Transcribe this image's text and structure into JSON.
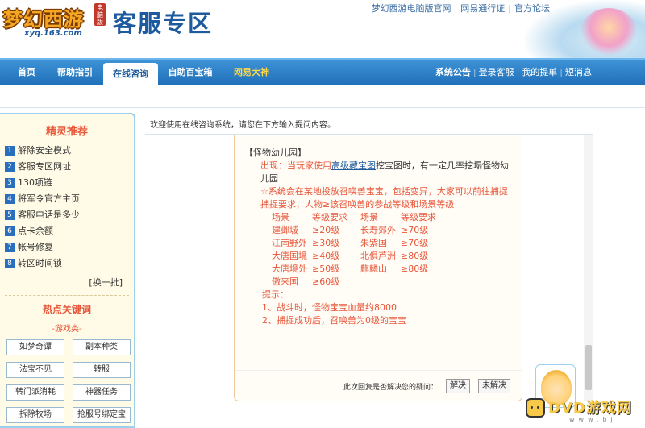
{
  "header": {
    "logo_text": "梦幻西游",
    "logo_badge": "电脑版",
    "logo_url": "xyq.163.com",
    "site_title": "客服专区",
    "top_links": [
      "梦幻西游电脑版官网",
      "网易通行证",
      "官方论坛"
    ]
  },
  "nav": {
    "tabs": [
      {
        "label": "首页"
      },
      {
        "label": "帮助指引"
      },
      {
        "label": "在线咨询"
      },
      {
        "label": "自助百宝箱"
      },
      {
        "label": "网易大神"
      }
    ],
    "active_tab": "在线咨询",
    "right_links": [
      "系统公告",
      "登录客服",
      "我的提单",
      "短消息"
    ]
  },
  "sidebar": {
    "recommend_title": "精灵推荐",
    "recommend_items": [
      {
        "num": "1",
        "label": "解除安全模式"
      },
      {
        "num": "2",
        "label": "客服专区网址"
      },
      {
        "num": "3",
        "label": "130项链"
      },
      {
        "num": "4",
        "label": "将军令官方主页"
      },
      {
        "num": "5",
        "label": "客服电话是多少"
      },
      {
        "num": "6",
        "label": "点卡余额"
      },
      {
        "num": "7",
        "label": "帐号修复"
      },
      {
        "num": "8",
        "label": "转区时间锁"
      }
    ],
    "more_link": "[换一批]",
    "hot_title": "热点关键词",
    "hot_subtitle": "-游戏类-",
    "keywords": [
      "如梦奇谭",
      "副本种类",
      "法宝不见",
      "转服",
      "转门派消耗",
      "神器任务",
      "拆除牧场",
      "抢服号绑定宝"
    ]
  },
  "main": {
    "welcome": "欢迎使用在线咨询系统，请您在下方输入提问内容。",
    "answer": {
      "title": "【怪物幼儿园】",
      "line1_prefix": "出现：当玩家使用",
      "line1_link": "高级藏宝图",
      "line1_suffix": "挖宝图时，有一定几率挖塌怪物幼儿园",
      "line2": "☆系统会在某地投放召唤兽宝宝，包括变异，大家可以前往捕捉",
      "line3": "捕捉要求，人物≥该召唤兽的参战等级和场景等级",
      "table_header": [
        "场景",
        "等级要求",
        "场景",
        "等级要求"
      ],
      "table_rows": [
        [
          "建邺城",
          "≥20级",
          "长寿郊外",
          "≥70级"
        ],
        [
          "江南野外",
          "≥30级",
          "朱紫国",
          "≥70级"
        ],
        [
          "大唐国境",
          "≥40级",
          "北俱芦洲",
          "≥80级"
        ],
        [
          "大唐境外",
          "≥50级",
          "麒麟山",
          "≥80级"
        ],
        [
          "傲来国",
          "≥60级",
          "",
          ""
        ]
      ],
      "tips_title": "提示：",
      "tips": [
        "1、战斗时，怪物宝宝血量约8000",
        "2、捕捉成功后，召唤兽为0级的宝宝"
      ]
    },
    "feedback_question": "此次回复是否解决您的疑问：",
    "resolved_label": "解决",
    "unresolved_label": "未解决"
  },
  "watermark": {
    "text": "DVD游戏网",
    "sub": "www.bj"
  }
}
